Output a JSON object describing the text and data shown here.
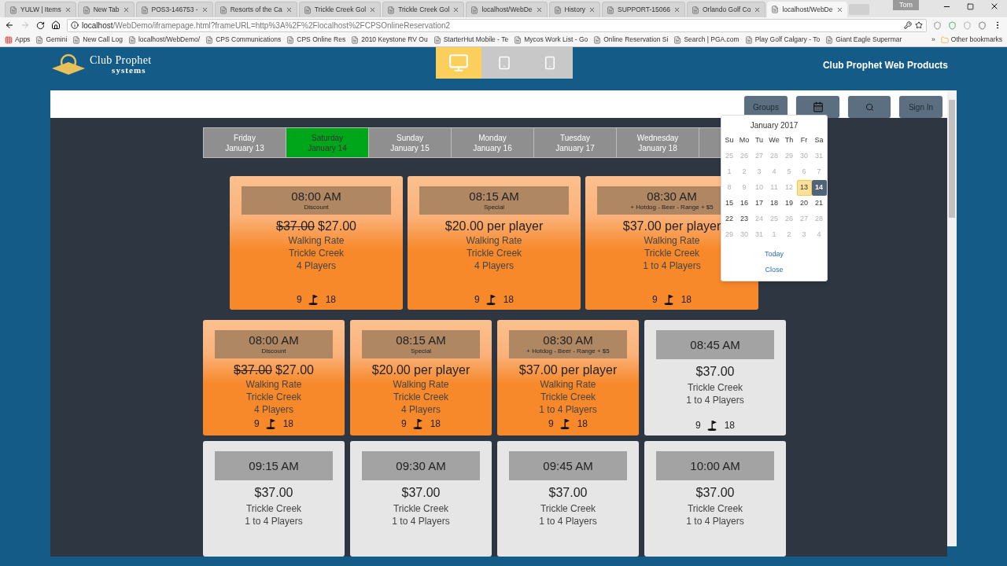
{
  "browser": {
    "tabs": [
      {
        "title": "YULW | Items",
        "selected": false
      },
      {
        "title": "New Tab",
        "selected": false
      },
      {
        "title": "POS3-146753 -",
        "selected": false
      },
      {
        "title": "Resorts of the Ca",
        "selected": false
      },
      {
        "title": "Trickle Creek Gol",
        "selected": false
      },
      {
        "title": "Trickle Creek Gol",
        "selected": false
      },
      {
        "title": "localhost/WebDe",
        "selected": false
      },
      {
        "title": "History",
        "selected": false
      },
      {
        "title": "SUPPORT-15066",
        "selected": false
      },
      {
        "title": "Orlando Golf Co",
        "selected": false
      },
      {
        "title": "localhost/WebDe",
        "selected": true
      }
    ],
    "user": "Tom",
    "address": {
      "host": "localhost",
      "path": "/WebDemo/iframepage.html?frameURL=http%3A%2F%2Flocalhost%2FCPSOnlineReservation2"
    },
    "bookmarks": [
      "Apps",
      "Gemini",
      "New Call Log",
      "localhost/WebDemo/",
      "CPS Communications",
      "CPS Online Res",
      "2010 Keystone RV Ou",
      "StarterHut Mobile - Te",
      "Mycos Work List - Go",
      "Online Reservation Si",
      "Search | PGA.com",
      "Play Golf Calgary - To",
      "Giant Eagle Supermar"
    ],
    "more_bookmarks": "»",
    "other_bookmarks": "Other bookmarks"
  },
  "header": {
    "logo": {
      "name": "Club Prophet",
      "sub": "systems"
    },
    "devices": [
      {
        "kind": "desktop",
        "selected": true
      },
      {
        "kind": "tablet",
        "selected": false
      },
      {
        "kind": "phone",
        "selected": false
      }
    ],
    "title": "Club Prophet Web Products"
  },
  "toolbar": {
    "groups": "Groups",
    "sign_in": "Sign In"
  },
  "days": [
    {
      "weekday": "Friday",
      "date": "January 13",
      "selected": false
    },
    {
      "weekday": "Saturday",
      "date": "January 14",
      "selected": true
    },
    {
      "weekday": "Sunday",
      "date": "January 15",
      "selected": false
    },
    {
      "weekday": "Monday",
      "date": "January 16",
      "selected": false
    },
    {
      "weekday": "Tuesday",
      "date": "January 17",
      "selected": false
    },
    {
      "weekday": "Wednesday",
      "date": "January 18",
      "selected": false
    }
  ],
  "calendar": {
    "month": "January 2017",
    "weekdays": [
      "Su",
      "Mo",
      "Tu",
      "We",
      "Th",
      "Fr",
      "Sa"
    ],
    "weeks": [
      [
        {
          "label": "25",
          "disabled": true,
          "today": false,
          "selected": false
        },
        {
          "label": "26",
          "disabled": true,
          "today": false,
          "selected": false
        },
        {
          "label": "27",
          "disabled": true,
          "today": false,
          "selected": false
        },
        {
          "label": "28",
          "disabled": true,
          "today": false,
          "selected": false
        },
        {
          "label": "29",
          "disabled": true,
          "today": false,
          "selected": false
        },
        {
          "label": "30",
          "disabled": true,
          "today": false,
          "selected": false
        },
        {
          "label": "31",
          "disabled": true,
          "today": false,
          "selected": false
        }
      ],
      [
        {
          "label": "1",
          "disabled": true,
          "today": false,
          "selected": false
        },
        {
          "label": "2",
          "disabled": true,
          "today": false,
          "selected": false
        },
        {
          "label": "3",
          "disabled": true,
          "today": false,
          "selected": false
        },
        {
          "label": "4",
          "disabled": true,
          "today": false,
          "selected": false
        },
        {
          "label": "5",
          "disabled": true,
          "today": false,
          "selected": false
        },
        {
          "label": "6",
          "disabled": true,
          "today": false,
          "selected": false
        },
        {
          "label": "7",
          "disabled": true,
          "today": false,
          "selected": false
        }
      ],
      [
        {
          "label": "8",
          "disabled": true,
          "today": false,
          "selected": false
        },
        {
          "label": "9",
          "disabled": true,
          "today": false,
          "selected": false
        },
        {
          "label": "10",
          "disabled": true,
          "today": false,
          "selected": false
        },
        {
          "label": "11",
          "disabled": true,
          "today": false,
          "selected": false
        },
        {
          "label": "12",
          "disabled": true,
          "today": false,
          "selected": false
        },
        {
          "label": "13",
          "disabled": false,
          "today": true,
          "selected": false
        },
        {
          "label": "14",
          "disabled": false,
          "today": false,
          "selected": true
        }
      ],
      [
        {
          "label": "15",
          "disabled": false,
          "today": false,
          "selected": false
        },
        {
          "label": "16",
          "disabled": false,
          "today": false,
          "selected": false
        },
        {
          "label": "17",
          "disabled": false,
          "today": false,
          "selected": false
        },
        {
          "label": "18",
          "disabled": false,
          "today": false,
          "selected": false
        },
        {
          "label": "19",
          "disabled": false,
          "today": false,
          "selected": false
        },
        {
          "label": "20",
          "disabled": false,
          "today": false,
          "selected": false
        },
        {
          "label": "21",
          "disabled": false,
          "today": false,
          "selected": false
        }
      ],
      [
        {
          "label": "22",
          "disabled": false,
          "today": false,
          "selected": false
        },
        {
          "label": "23",
          "disabled": false,
          "today": false,
          "selected": false
        },
        {
          "label": "24",
          "disabled": true,
          "today": false,
          "selected": false
        },
        {
          "label": "25",
          "disabled": true,
          "today": false,
          "selected": false
        },
        {
          "label": "26",
          "disabled": true,
          "today": false,
          "selected": false
        },
        {
          "label": "27",
          "disabled": true,
          "today": false,
          "selected": false
        },
        {
          "label": "28",
          "disabled": true,
          "today": false,
          "selected": false
        }
      ],
      [
        {
          "label": "29",
          "disabled": true,
          "today": false,
          "selected": false
        },
        {
          "label": "30",
          "disabled": true,
          "today": false,
          "selected": false
        },
        {
          "label": "31",
          "disabled": true,
          "today": false,
          "selected": false
        },
        {
          "label": "1",
          "disabled": true,
          "today": false,
          "selected": false
        },
        {
          "label": "2",
          "disabled": true,
          "today": false,
          "selected": false
        },
        {
          "label": "3",
          "disabled": true,
          "today": false,
          "selected": false
        },
        {
          "label": "4",
          "disabled": true,
          "today": false,
          "selected": false
        }
      ]
    ],
    "today": "Today",
    "close": "Close"
  },
  "featured": [
    {
      "kind": "special",
      "time": "08:00 AM",
      "tag": "Discount",
      "old_price": "$37.00",
      "price": "$27.00",
      "rate": "Walking Rate",
      "course": "Trickle Creek",
      "players": "4 Players",
      "holes": [
        "9",
        "18"
      ]
    },
    {
      "kind": "special",
      "time": "08:15 AM",
      "tag": "Special",
      "price": "$20.00 per player",
      "rate": "Walking Rate",
      "course": "Trickle Creek",
      "players": "4 Players",
      "holes": [
        "9",
        "18"
      ]
    },
    {
      "kind": "special",
      "time": "08:30 AM",
      "tag": "+ Hotdog - Beer - Range + $5",
      "price": "$37.00 per player",
      "rate": "Walking Rate",
      "course": "Trickle Creek",
      "players": "1 to 4 Players",
      "holes": [
        "9",
        "18"
      ]
    }
  ],
  "tee_times": [
    {
      "kind": "special",
      "time": "08:00 AM",
      "tag": "Discount",
      "old_price": "$37.00",
      "price": "$27.00",
      "rate": "Walking Rate",
      "course": "Trickle Creek",
      "players": "4 Players",
      "holes": [
        "9",
        "18"
      ]
    },
    {
      "kind": "special",
      "time": "08:15 AM",
      "tag": "Special",
      "price": "$20.00 per player",
      "rate": "Walking Rate",
      "course": "Trickle Creek",
      "players": "4 Players",
      "holes": [
        "9",
        "18"
      ]
    },
    {
      "kind": "special",
      "time": "08:30 AM",
      "tag": "+ Hotdog - Beer - Range + $5",
      "price": "$37.00 per player",
      "rate": "Walking Rate",
      "course": "Trickle Creek",
      "players": "1 to 4 Players",
      "holes": [
        "9",
        "18"
      ]
    },
    {
      "kind": "regular",
      "time": "08:45 AM",
      "price": "$37.00",
      "course": "Trickle Creek",
      "players": "1 to 4 Players",
      "holes": [
        "9",
        "18"
      ]
    },
    {
      "kind": "regular",
      "time": "09:15 AM",
      "price": "$37.00",
      "course": "Trickle Creek",
      "players": "1 to 4 Players"
    },
    {
      "kind": "regular",
      "time": "09:30 AM",
      "price": "$37.00",
      "course": "Trickle Creek",
      "players": "1 to 4 Players"
    },
    {
      "kind": "regular",
      "time": "09:45 AM",
      "price": "$37.00",
      "course": "Trickle Creek",
      "players": "1 to 4 Players"
    },
    {
      "kind": "regular",
      "time": "10:00 AM",
      "price": "$37.00",
      "course": "Trickle Creek",
      "players": "1 to 4 Players"
    }
  ]
}
